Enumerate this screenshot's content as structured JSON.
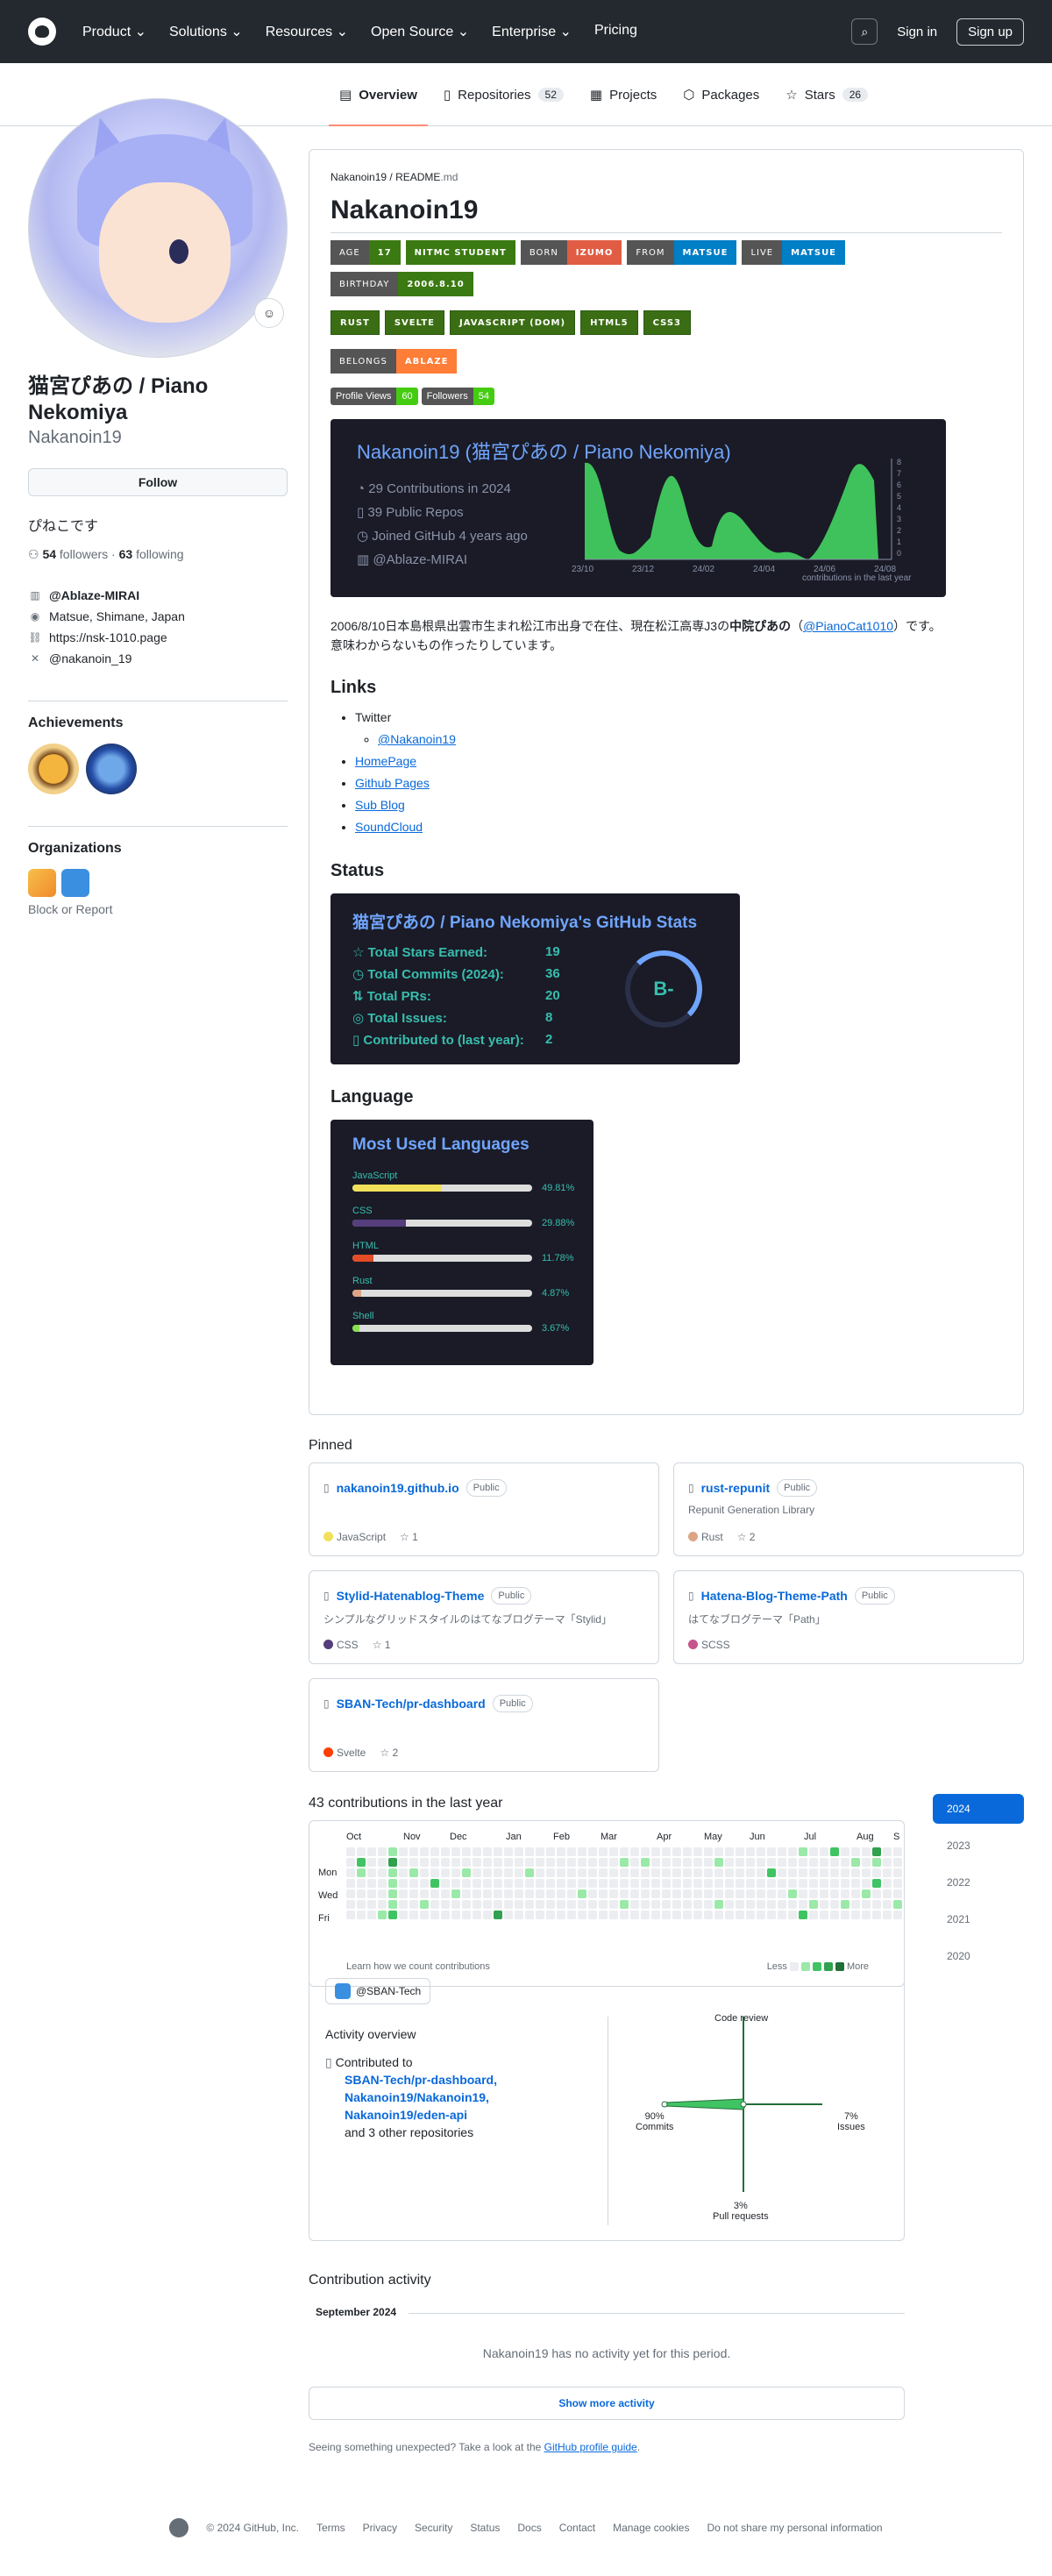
{
  "header": {
    "nav": [
      "Product",
      "Solutions",
      "Resources",
      "Open Source",
      "Enterprise",
      "Pricing"
    ],
    "signin": "Sign in",
    "signup": "Sign up"
  },
  "tabs": [
    {
      "label": "Overview"
    },
    {
      "label": "Repositories",
      "count": "52"
    },
    {
      "label": "Projects"
    },
    {
      "label": "Packages"
    },
    {
      "label": "Stars",
      "count": "26"
    }
  ],
  "profile": {
    "name": "猫宮ぴあの / Piano Nekomiya",
    "login": "Nakanoin19",
    "follow": "Follow",
    "bio": "ぴねこです",
    "followers": "54",
    "followers_label": "followers",
    "following": "63",
    "following_label": "following",
    "company": "@Ablaze-MIRAI",
    "location": "Matsue, Shimane, Japan",
    "url": "https://nsk-1010.page",
    "twitter": "@nakanoin_19",
    "achievements_title": "Achievements",
    "orgs_title": "Organizations",
    "block": "Block or Report"
  },
  "readme": {
    "path_user": "Nakanoin19",
    "path_file": "README",
    "path_ext": ".md",
    "title": "Nakanoin19",
    "badges_row1": [
      {
        "l": "AGE",
        "r": "17",
        "c": "#3b7a12"
      },
      {
        "l": "",
        "r": "NITMC STUDENT",
        "c": "#3b7a12"
      },
      {
        "l": "BORN",
        "r": "IZUMO",
        "c": "#e05d44"
      },
      {
        "l": "FROM",
        "r": "MATSUE",
        "c": "#007ec6"
      },
      {
        "l": "LIVE",
        "r": "MATSUE",
        "c": "#007ec6"
      }
    ],
    "badge_birthday": {
      "l": "BIRTHDAY",
      "r": "2006.8.10",
      "c": "#3b7a12"
    },
    "badges_tech": [
      "RUST",
      "SVELTE",
      "JAVASCRIPT (DOM)",
      "HTML5",
      "CSS3"
    ],
    "badge_belongs": {
      "l": "BELONGS",
      "r": "ABLAZE",
      "c": "#fe7d37"
    },
    "profile_views": {
      "l": "Profile Views",
      "r": "60"
    },
    "followers_badge": {
      "l": "Followers",
      "r": "54"
    },
    "gh_card": {
      "title": "Nakanoin19 (猫宮ぴあの / Piano Nekomiya)",
      "lines": [
        "29 Contributions in 2024",
        "39 Public Repos",
        "Joined GitHub 4 years ago",
        "@Ablaze-MIRAI"
      ],
      "xlabels": [
        "23/10",
        "23/12",
        "24/02",
        "24/04",
        "24/06",
        "24/08"
      ],
      "ylabels": [
        "8",
        "7",
        "6",
        "5",
        "4",
        "3",
        "2",
        "1",
        "0"
      ],
      "caption": "contributions in the last year"
    },
    "para_1": "2006/8/10日本島根県出雲市生まれ松江市出身で在住、現在松江高専J3の",
    "para_bold": "中院ぴあの",
    "para_link": "@PianoCat1010",
    "para_2": "です。",
    "para_3": "意味わからないもの作ったりしています。",
    "links_title": "Links",
    "links": {
      "twitter": "Twitter",
      "twitter_sub": "@Nakanoin19",
      "items": [
        "HomePage",
        "Github Pages",
        "Sub Blog",
        "SoundCloud"
      ]
    },
    "status_title": "Status",
    "stats": {
      "title": "猫宮ぴあの / Piano Nekomiya's GitHub Stats",
      "rows": [
        {
          "k": "Total Stars Earned:",
          "v": "19"
        },
        {
          "k": "Total Commits (2024):",
          "v": "36"
        },
        {
          "k": "Total PRs:",
          "v": "20"
        },
        {
          "k": "Total Issues:",
          "v": "8"
        },
        {
          "k": "Contributed to (last year):",
          "v": "2"
        }
      ],
      "grade": "B-"
    },
    "language_title": "Language",
    "languages": {
      "title": "Most Used Languages",
      "items": [
        {
          "name": "JavaScript",
          "pct": "49.81%",
          "frac": 0.4981,
          "color": "#f1e05a"
        },
        {
          "name": "CSS",
          "pct": "29.88%",
          "frac": 0.2988,
          "color": "#563d7c"
        },
        {
          "name": "HTML",
          "pct": "11.78%",
          "frac": 0.1178,
          "color": "#e34c26"
        },
        {
          "name": "Rust",
          "pct": "4.87%",
          "frac": 0.0487,
          "color": "#dea584"
        },
        {
          "name": "Shell",
          "pct": "3.67%",
          "frac": 0.0367,
          "color": "#89e051"
        }
      ]
    }
  },
  "pinned": {
    "title": "Pinned",
    "items": [
      {
        "name": "nakanoin19.github.io",
        "vis": "Public",
        "desc": "",
        "lang": "JavaScript",
        "color": "#f1e05a",
        "stars": "1"
      },
      {
        "name": "rust-repunit",
        "vis": "Public",
        "desc": "Repunit Generation Library",
        "lang": "Rust",
        "color": "#dea584",
        "stars": "2"
      },
      {
        "name": "Stylid-Hatenablog-Theme",
        "vis": "Public",
        "desc": "シンプルなグリッドスタイルのはてなブログテーマ「Stylid」",
        "lang": "CSS",
        "color": "#563d7c",
        "stars": "1"
      },
      {
        "name": "Hatena-Blog-Theme-Path",
        "vis": "Public",
        "desc": "はてなブログテーマ「Path」",
        "lang": "SCSS",
        "color": "#c6538c",
        "stars": ""
      },
      {
        "name": "SBAN-Tech/pr-dashboard",
        "vis": "Public",
        "desc": "",
        "lang": "Svelte",
        "color": "#ff3e00",
        "stars": "2"
      }
    ]
  },
  "contributions": {
    "title": "43 contributions in the last year",
    "months": [
      "Oct",
      "Nov",
      "Dec",
      "Jan",
      "Feb",
      "Mar",
      "Apr",
      "May",
      "Jun",
      "Jul",
      "Aug",
      "S"
    ],
    "days": [
      "Mon",
      "Wed",
      "Fri"
    ],
    "learn": "Learn how we count contributions",
    "less": "Less",
    "more": "More",
    "years": [
      "2024",
      "2023",
      "2022",
      "2021",
      "2020"
    ]
  },
  "activity": {
    "org": "@SBAN-Tech",
    "overview": "Activity overview",
    "contributed_to": "Contributed to",
    "repos": "SBAN-Tech/pr-dashboard, Nakanoin19/Nakanoin19, Nakanoin19/eden-api",
    "others": "and 3 other repositories",
    "code_review": "Code review",
    "commits_pct": "90%",
    "commits": "Commits",
    "issues_pct": "7%",
    "issues": "Issues",
    "prs_pct": "3%",
    "prs": "Pull requests"
  },
  "contribution_activity": {
    "title": "Contribution activity",
    "month": "September 2024",
    "none": "Nakanoin19 has no activity yet for this period.",
    "more": "Show more activity",
    "guide_pre": "Seeing something unexpected? Take a look at the",
    "guide_link": "GitHub profile guide",
    "guide_post": "."
  },
  "footer": [
    "© 2024 GitHub, Inc.",
    "Terms",
    "Privacy",
    "Security",
    "Status",
    "Docs",
    "Contact",
    "Manage cookies",
    "Do not share my personal information"
  ]
}
